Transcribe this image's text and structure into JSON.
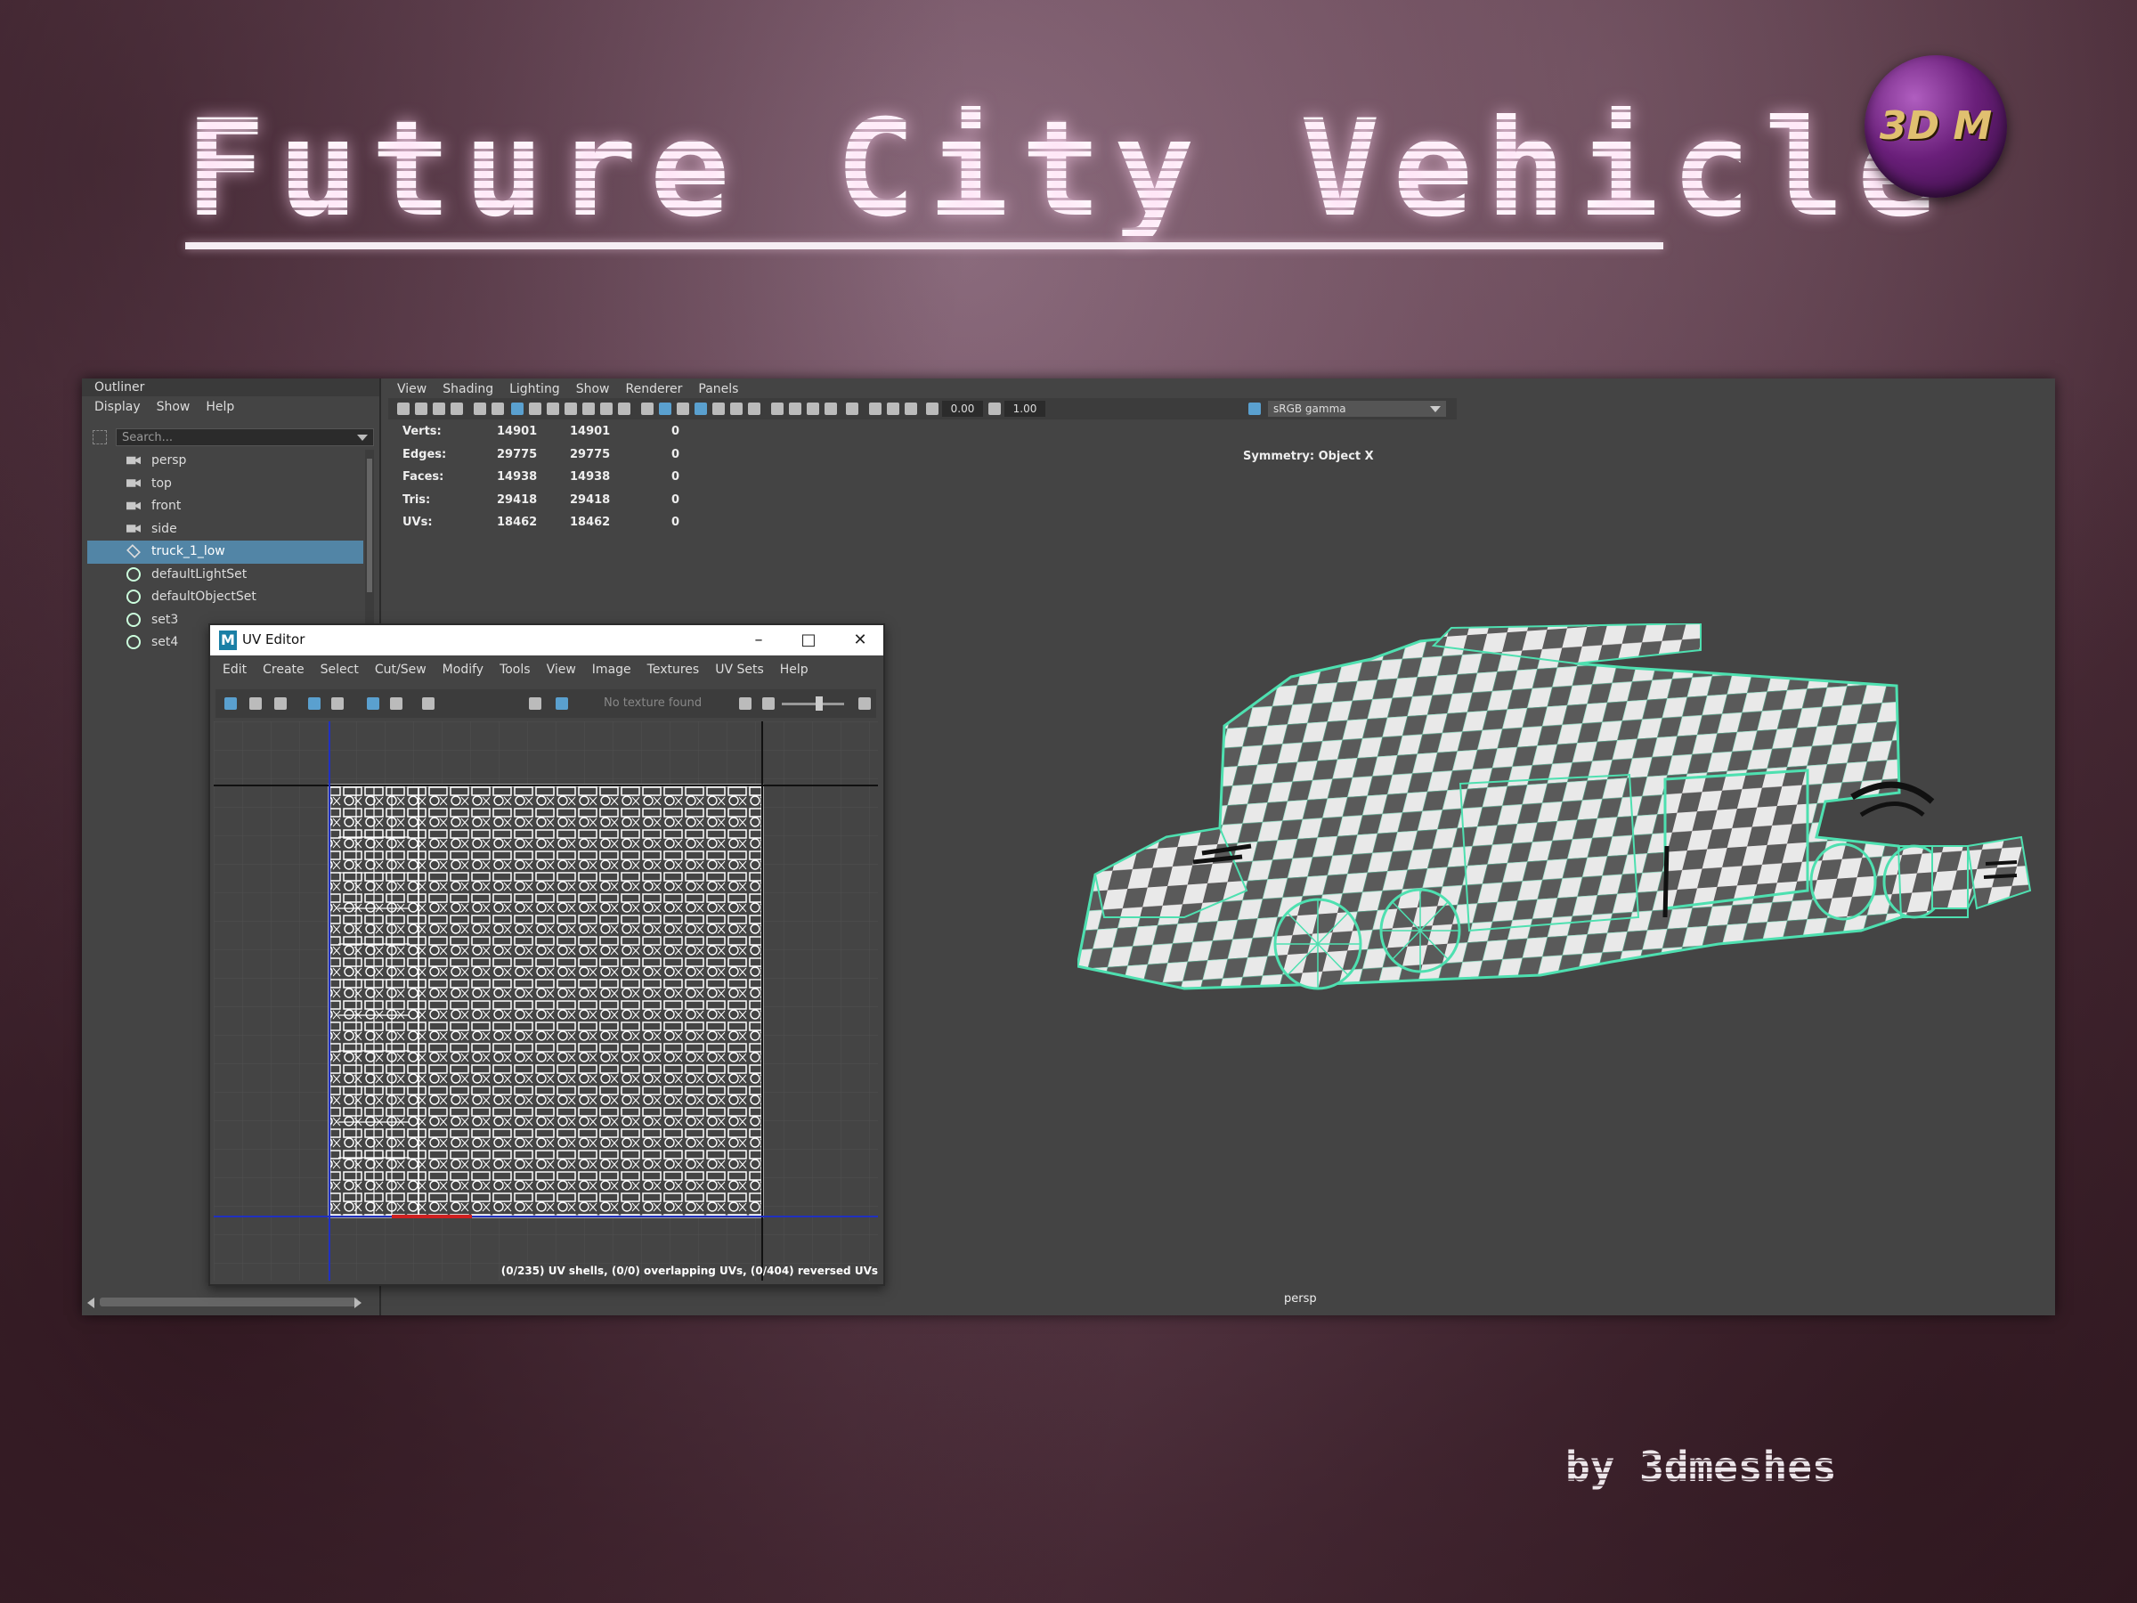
{
  "poster": {
    "title": "Future City Vehicle",
    "logo_text": "3D M",
    "credit": "by 3dmeshes"
  },
  "outliner": {
    "tab_label": "Outliner",
    "menu": [
      "Display",
      "Show",
      "Help"
    ],
    "search_placeholder": "Search...",
    "items": [
      {
        "label": "persp",
        "icon": "camera-icon"
      },
      {
        "label": "top",
        "icon": "camera-icon"
      },
      {
        "label": "front",
        "icon": "camera-icon"
      },
      {
        "label": "side",
        "icon": "camera-icon"
      },
      {
        "label": "truck_1_low",
        "icon": "mesh-icon",
        "selected": true
      },
      {
        "label": "defaultLightSet",
        "icon": "set-icon"
      },
      {
        "label": "defaultObjectSet",
        "icon": "set-icon"
      },
      {
        "label": "set3",
        "icon": "set-icon"
      },
      {
        "label": "set4",
        "icon": "set-icon"
      }
    ]
  },
  "viewport": {
    "menu": [
      "View",
      "Shading",
      "Lighting",
      "Show",
      "Renderer",
      "Panels"
    ],
    "exposure": "0.00",
    "gamma_value": "1.00",
    "color_space": "sRGB gamma",
    "hud": [
      {
        "label": "Verts:",
        "a": "14901",
        "b": "14901",
        "c": "0"
      },
      {
        "label": "Edges:",
        "a": "29775",
        "b": "29775",
        "c": "0"
      },
      {
        "label": "Faces:",
        "a": "14938",
        "b": "14938",
        "c": "0"
      },
      {
        "label": "Tris:",
        "a": "29418",
        "b": "29418",
        "c": "0"
      },
      {
        "label": "UVs:",
        "a": "18462",
        "b": "18462",
        "c": "0"
      }
    ],
    "symmetry": "Symmetry: Object X",
    "camera_label": "persp"
  },
  "uv_editor": {
    "title": "UV Editor",
    "menu": [
      "Edit",
      "Create",
      "Select",
      "Cut/Sew",
      "Modify",
      "Tools",
      "View",
      "Image",
      "Textures",
      "UV Sets",
      "Help"
    ],
    "texture_status": "No texture found",
    "status": "(0/235) UV shells, (0/0) overlapping UVs, (0/404) reversed UVs"
  },
  "colors": {
    "selection": "#5285a6",
    "wireframe": "#4ee0b0",
    "panel": "#444444"
  }
}
